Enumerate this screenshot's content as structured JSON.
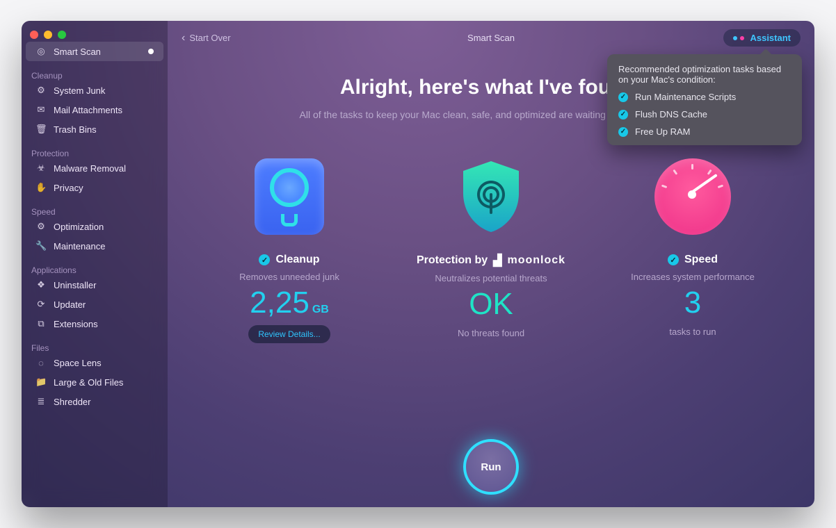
{
  "topbar": {
    "back_label": "Start Over",
    "title": "Smart Scan",
    "assistant_label": "Assistant"
  },
  "tooltip": {
    "heading": "Recommended optimization tasks based on your Mac's condition:",
    "items": [
      "Run Maintenance Scripts",
      "Flush DNS Cache",
      "Free Up RAM"
    ]
  },
  "hero": {
    "title": "Alright, here's what I've found.",
    "subtitle": "All of the tasks to keep your Mac clean, safe, and optimized are waiting for your decision."
  },
  "sidebar": {
    "active": "Smart Scan",
    "groups": [
      {
        "header": null,
        "items": [
          {
            "icon": "radar-icon",
            "label": "Smart Scan",
            "active": true,
            "badge": true
          }
        ]
      },
      {
        "header": "Cleanup",
        "items": [
          {
            "icon": "gear-icon",
            "label": "System Junk"
          },
          {
            "icon": "mail-icon",
            "label": "Mail Attachments"
          },
          {
            "icon": "trash-icon",
            "label": "Trash Bins"
          }
        ]
      },
      {
        "header": "Protection",
        "items": [
          {
            "icon": "biohazard-icon",
            "label": "Malware Removal"
          },
          {
            "icon": "hand-icon",
            "label": "Privacy"
          }
        ]
      },
      {
        "header": "Speed",
        "items": [
          {
            "icon": "sliders-icon",
            "label": "Optimization"
          },
          {
            "icon": "wrench-icon",
            "label": "Maintenance"
          }
        ]
      },
      {
        "header": "Applications",
        "items": [
          {
            "icon": "puzzle-icon",
            "label": "Uninstaller"
          },
          {
            "icon": "refresh-icon",
            "label": "Updater"
          },
          {
            "icon": "plugin-icon",
            "label": "Extensions"
          }
        ]
      },
      {
        "header": "Files",
        "items": [
          {
            "icon": "lens-icon",
            "label": "Space Lens"
          },
          {
            "icon": "folder-icon",
            "label": "Large & Old Files"
          },
          {
            "icon": "shredder-icon",
            "label": "Shredder"
          }
        ]
      }
    ]
  },
  "cards": {
    "cleanup": {
      "title": "Cleanup",
      "sub": "Removes unneeded junk",
      "value": "2,25",
      "unit": "GB",
      "action": "Review Details..."
    },
    "protection": {
      "title_prefix": "Protection by",
      "brand": "moonlock",
      "sub": "Neutralizes potential threats",
      "value": "OK",
      "status": "No threats found"
    },
    "speed": {
      "title": "Speed",
      "sub": "Increases system performance",
      "value": "3",
      "status": "tasks to run"
    }
  },
  "run_label": "Run",
  "icon_glyphs": {
    "radar-icon": "◎",
    "gear-icon": "⚙",
    "mail-icon": "✉",
    "trash-icon": "🗑",
    "biohazard-icon": "☣",
    "hand-icon": "✋",
    "sliders-icon": "⚙",
    "wrench-icon": "🔧",
    "puzzle-icon": "❖",
    "refresh-icon": "⟳",
    "plugin-icon": "⧉",
    "lens-icon": "◌",
    "folder-icon": "📁",
    "shredder-icon": "≣"
  }
}
